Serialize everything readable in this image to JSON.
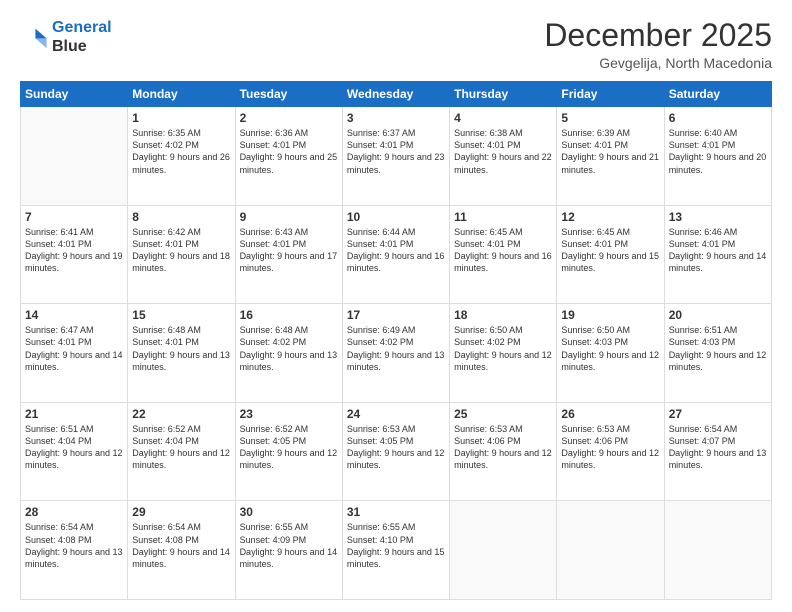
{
  "logo": {
    "line1": "General",
    "line2": "Blue"
  },
  "title": "December 2025",
  "subtitle": "Gevgelija, North Macedonia",
  "days_header": [
    "Sunday",
    "Monday",
    "Tuesday",
    "Wednesday",
    "Thursday",
    "Friday",
    "Saturday"
  ],
  "weeks": [
    [
      {
        "num": "",
        "sunrise": "",
        "sunset": "",
        "daylight": ""
      },
      {
        "num": "1",
        "sunrise": "Sunrise: 6:35 AM",
        "sunset": "Sunset: 4:02 PM",
        "daylight": "Daylight: 9 hours and 26 minutes."
      },
      {
        "num": "2",
        "sunrise": "Sunrise: 6:36 AM",
        "sunset": "Sunset: 4:01 PM",
        "daylight": "Daylight: 9 hours and 25 minutes."
      },
      {
        "num": "3",
        "sunrise": "Sunrise: 6:37 AM",
        "sunset": "Sunset: 4:01 PM",
        "daylight": "Daylight: 9 hours and 23 minutes."
      },
      {
        "num": "4",
        "sunrise": "Sunrise: 6:38 AM",
        "sunset": "Sunset: 4:01 PM",
        "daylight": "Daylight: 9 hours and 22 minutes."
      },
      {
        "num": "5",
        "sunrise": "Sunrise: 6:39 AM",
        "sunset": "Sunset: 4:01 PM",
        "daylight": "Daylight: 9 hours and 21 minutes."
      },
      {
        "num": "6",
        "sunrise": "Sunrise: 6:40 AM",
        "sunset": "Sunset: 4:01 PM",
        "daylight": "Daylight: 9 hours and 20 minutes."
      }
    ],
    [
      {
        "num": "7",
        "sunrise": "Sunrise: 6:41 AM",
        "sunset": "Sunset: 4:01 PM",
        "daylight": "Daylight: 9 hours and 19 minutes."
      },
      {
        "num": "8",
        "sunrise": "Sunrise: 6:42 AM",
        "sunset": "Sunset: 4:01 PM",
        "daylight": "Daylight: 9 hours and 18 minutes."
      },
      {
        "num": "9",
        "sunrise": "Sunrise: 6:43 AM",
        "sunset": "Sunset: 4:01 PM",
        "daylight": "Daylight: 9 hours and 17 minutes."
      },
      {
        "num": "10",
        "sunrise": "Sunrise: 6:44 AM",
        "sunset": "Sunset: 4:01 PM",
        "daylight": "Daylight: 9 hours and 16 minutes."
      },
      {
        "num": "11",
        "sunrise": "Sunrise: 6:45 AM",
        "sunset": "Sunset: 4:01 PM",
        "daylight": "Daylight: 9 hours and 16 minutes."
      },
      {
        "num": "12",
        "sunrise": "Sunrise: 6:45 AM",
        "sunset": "Sunset: 4:01 PM",
        "daylight": "Daylight: 9 hours and 15 minutes."
      },
      {
        "num": "13",
        "sunrise": "Sunrise: 6:46 AM",
        "sunset": "Sunset: 4:01 PM",
        "daylight": "Daylight: 9 hours and 14 minutes."
      }
    ],
    [
      {
        "num": "14",
        "sunrise": "Sunrise: 6:47 AM",
        "sunset": "Sunset: 4:01 PM",
        "daylight": "Daylight: 9 hours and 14 minutes."
      },
      {
        "num": "15",
        "sunrise": "Sunrise: 6:48 AM",
        "sunset": "Sunset: 4:01 PM",
        "daylight": "Daylight: 9 hours and 13 minutes."
      },
      {
        "num": "16",
        "sunrise": "Sunrise: 6:48 AM",
        "sunset": "Sunset: 4:02 PM",
        "daylight": "Daylight: 9 hours and 13 minutes."
      },
      {
        "num": "17",
        "sunrise": "Sunrise: 6:49 AM",
        "sunset": "Sunset: 4:02 PM",
        "daylight": "Daylight: 9 hours and 13 minutes."
      },
      {
        "num": "18",
        "sunrise": "Sunrise: 6:50 AM",
        "sunset": "Sunset: 4:02 PM",
        "daylight": "Daylight: 9 hours and 12 minutes."
      },
      {
        "num": "19",
        "sunrise": "Sunrise: 6:50 AM",
        "sunset": "Sunset: 4:03 PM",
        "daylight": "Daylight: 9 hours and 12 minutes."
      },
      {
        "num": "20",
        "sunrise": "Sunrise: 6:51 AM",
        "sunset": "Sunset: 4:03 PM",
        "daylight": "Daylight: 9 hours and 12 minutes."
      }
    ],
    [
      {
        "num": "21",
        "sunrise": "Sunrise: 6:51 AM",
        "sunset": "Sunset: 4:04 PM",
        "daylight": "Daylight: 9 hours and 12 minutes."
      },
      {
        "num": "22",
        "sunrise": "Sunrise: 6:52 AM",
        "sunset": "Sunset: 4:04 PM",
        "daylight": "Daylight: 9 hours and 12 minutes."
      },
      {
        "num": "23",
        "sunrise": "Sunrise: 6:52 AM",
        "sunset": "Sunset: 4:05 PM",
        "daylight": "Daylight: 9 hours and 12 minutes."
      },
      {
        "num": "24",
        "sunrise": "Sunrise: 6:53 AM",
        "sunset": "Sunset: 4:05 PM",
        "daylight": "Daylight: 9 hours and 12 minutes."
      },
      {
        "num": "25",
        "sunrise": "Sunrise: 6:53 AM",
        "sunset": "Sunset: 4:06 PM",
        "daylight": "Daylight: 9 hours and 12 minutes."
      },
      {
        "num": "26",
        "sunrise": "Sunrise: 6:53 AM",
        "sunset": "Sunset: 4:06 PM",
        "daylight": "Daylight: 9 hours and 12 minutes."
      },
      {
        "num": "27",
        "sunrise": "Sunrise: 6:54 AM",
        "sunset": "Sunset: 4:07 PM",
        "daylight": "Daylight: 9 hours and 13 minutes."
      }
    ],
    [
      {
        "num": "28",
        "sunrise": "Sunrise: 6:54 AM",
        "sunset": "Sunset: 4:08 PM",
        "daylight": "Daylight: 9 hours and 13 minutes."
      },
      {
        "num": "29",
        "sunrise": "Sunrise: 6:54 AM",
        "sunset": "Sunset: 4:08 PM",
        "daylight": "Daylight: 9 hours and 14 minutes."
      },
      {
        "num": "30",
        "sunrise": "Sunrise: 6:55 AM",
        "sunset": "Sunset: 4:09 PM",
        "daylight": "Daylight: 9 hours and 14 minutes."
      },
      {
        "num": "31",
        "sunrise": "Sunrise: 6:55 AM",
        "sunset": "Sunset: 4:10 PM",
        "daylight": "Daylight: 9 hours and 15 minutes."
      },
      {
        "num": "",
        "sunrise": "",
        "sunset": "",
        "daylight": ""
      },
      {
        "num": "",
        "sunrise": "",
        "sunset": "",
        "daylight": ""
      },
      {
        "num": "",
        "sunrise": "",
        "sunset": "",
        "daylight": ""
      }
    ]
  ]
}
